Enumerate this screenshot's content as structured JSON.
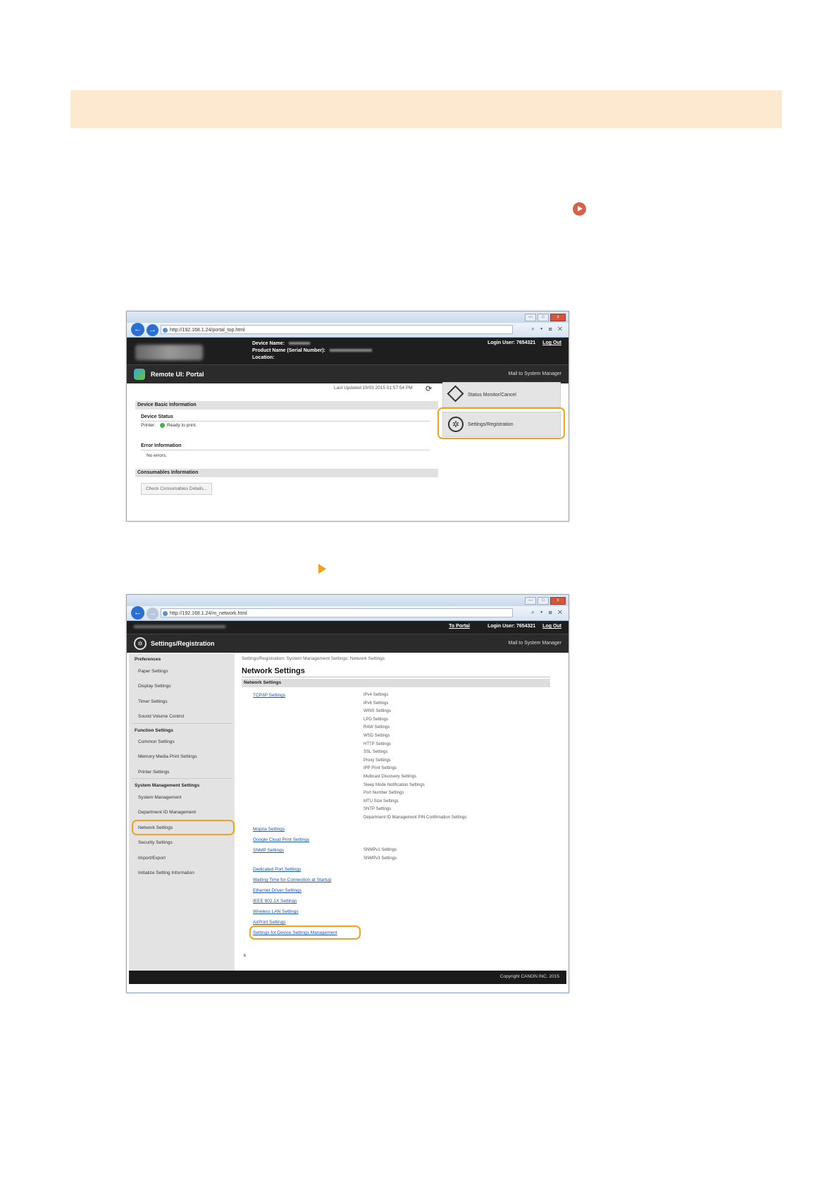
{
  "screenshot1": {
    "url": "http://192.168.1.24/portal_top.html",
    "window_buttons": [
      "—",
      "□",
      "x"
    ],
    "url_tools": "⌕ ▾ ⊠ ✕",
    "device_labels": [
      "Device Name:",
      "Product Name (Serial Number):",
      "Location:"
    ],
    "login_user_label": "Login User:",
    "login_user": "7654321",
    "logout": "Log Out",
    "portal_title": "Remote UI: Portal",
    "mail_link": "Mail to System Manager",
    "last_updated": "Last Updated:19/03 2015 01:57:54 PM",
    "sections": {
      "device_basic": "Device Basic Information",
      "device_status": "Device Status",
      "printer_label": "Printer:",
      "printer_status": "Ready to print.",
      "error_info": "Error Information",
      "no_errors": "No errors.",
      "consumables": "Consumables Information",
      "check_consumables": "Check Consumables Details..."
    },
    "buttons": {
      "status_monitor": "Status Monitor/Cancel",
      "settings_registration": "Settings/Registration"
    }
  },
  "screenshot2": {
    "url": "http://192.168.1.24/m_network.html",
    "window_buttons": [
      "—",
      "□",
      "x"
    ],
    "url_tools": "⌕ ▾ ⊠ ✕",
    "to_portal": "To Portal",
    "login_user_label": "Login User:",
    "login_user": "7654321",
    "logout": "Log Out",
    "page_title": "Settings/Registration",
    "mail_link": "Mail to System Manager",
    "sidebar": {
      "preferences": "Preferences",
      "preferences_items": [
        "Paper Settings",
        "Display Settings",
        "Timer Settings",
        "Sound Volume Control"
      ],
      "function": "Function Settings",
      "function_items": [
        "Common Settings",
        "Memory Media Print Settings",
        "Printer Settings"
      ],
      "system": "System Management Settings",
      "system_items": [
        "System Management",
        "Department ID Management",
        "Network Settings",
        "Security Settings",
        "Import/Export",
        "Initialize Setting Information"
      ]
    },
    "breadcrumb": "Settings/Registration: System Management Settings: Network Settings",
    "main_title": "Network Settings",
    "section_bar": "Network Settings",
    "tcpip_link": "TCP/IP Settings",
    "tcpip_items": [
      "IPv4 Settings",
      "IPv6 Settings",
      "WINS Settings",
      "LPD Settings",
      "RAW Settings",
      "WSD Settings",
      "HTTP Settings",
      "SSL Settings",
      "Proxy Settings",
      "IPP Print Settings",
      "Multicast Discovery Settings",
      "Sleep Mode Notification Settings",
      "Port Number Settings",
      "MTU Size Settings",
      "SNTP Settings",
      "Department ID Management PIN Confirmation Settings"
    ],
    "mopria_link": "Mopria Settings",
    "google_link": "Google Cloud Print Settings",
    "snmp_link": "SNMP Settings",
    "snmp_items": [
      "SNMPv1 Settings",
      "SNMPv3 Settings"
    ],
    "links": [
      "Dedicated Port Settings",
      "Waiting Time for Connection at Startup",
      "Ethernet Driver Settings",
      "IEEE 802.1X Settings",
      "Wireless LAN Settings",
      "AirPrint Settings"
    ],
    "device_mgmt_link": "Settings for Device Settings Management",
    "to_top": "⌅",
    "copyright": "Copyright CANON INC. 2015"
  }
}
